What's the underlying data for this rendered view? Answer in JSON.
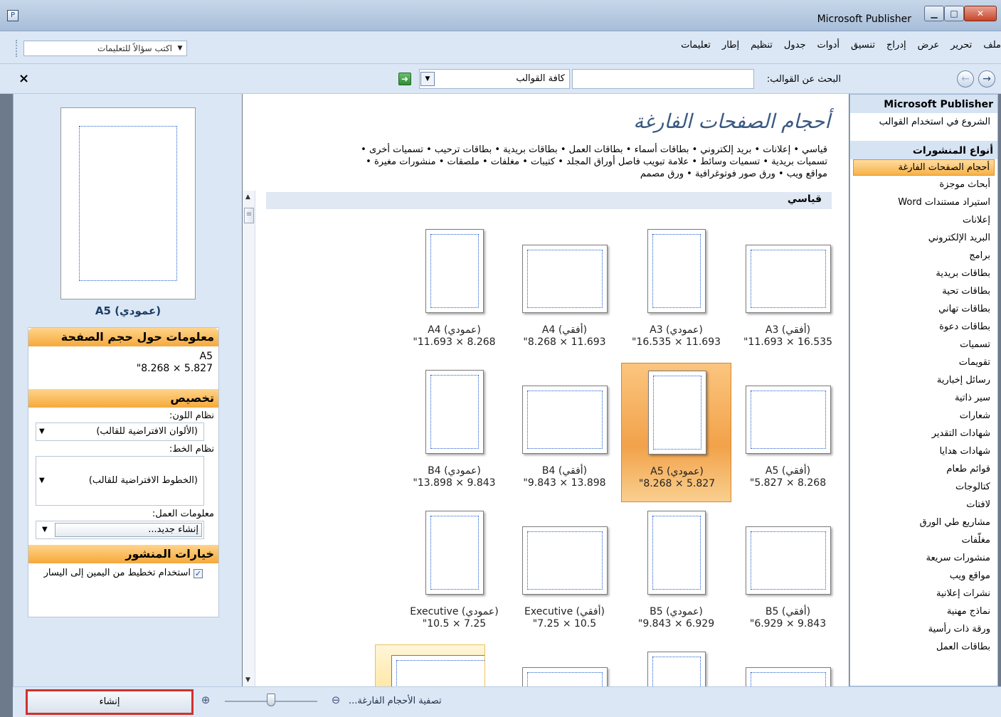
{
  "window": {
    "title": "Microsoft Publisher",
    "min_label": "▁",
    "max_label": "□",
    "close_label": "✕"
  },
  "menu": {
    "items": [
      "ملف",
      "تحرير",
      "عرض",
      "إدراج",
      "تنسيق",
      "أدوات",
      "جدول",
      "تنظيم",
      "إطار",
      "تعليمات"
    ],
    "ask_placeholder": "اكتب سؤالاً للتعليمات"
  },
  "toolbar": {
    "search_label": "البحث عن القوالب:",
    "search_value": "",
    "category_value": "كافة القوالب",
    "close_label": "×"
  },
  "nav": {
    "app_header": "Microsoft Publisher",
    "getting_started": "الشروع في استخدام القوالب",
    "types_header": "أنواع المنشورات",
    "items": [
      "أحجام الصفحات الفارغة",
      "أبحاث موجزة",
      "استيراد مستندات Word",
      "إعلانات",
      "البريد الإلكتروني",
      "برامج",
      "بطاقات بريدية",
      "بطاقات تحية",
      "بطاقات تهاني",
      "بطاقات دعوة",
      "تسميات",
      "تقويمات",
      "رسائل إخبارية",
      "سير ذاتية",
      "شعارات",
      "شهادات التقدير",
      "شهادات هدايا",
      "قوائم طعام",
      "كتالوجات",
      "لافتات",
      "مشاريع طي الورق",
      "مغلّفات",
      "منشورات سريعة",
      "مواقع ويب",
      "نشرات إعلانية",
      "نماذج مهنية",
      "ورقة ذات رأسية",
      "بطاقات العمل"
    ],
    "selected_index": 0
  },
  "content": {
    "title": "أحجام الصفحات الفارغة",
    "categories_line1": "قياسي • إعلانات • بريد إلكتروني • بطاقات أسماء • بطاقات العمل • بطاقات بريدية • بطاقات ترحيب • تسميات أخرى •",
    "categories_line2": "تسميات بريدية • تسميات وسائط • علامة تبويب فاصل أوراق المجلد • كتيبات • مغلفات • ملصقات • منشورات مغيرة •",
    "categories_line3": "مواقع ويب • ورق صور فوتوغرافية • ورق مصمم",
    "section": "قياسي",
    "templates": [
      {
        "name": "A3 (أفقي)",
        "size": "\"11.693 × 16.535"
      },
      {
        "name": "A3 (عمودي)",
        "size": "\"16.535 × 11.693"
      },
      {
        "name": "A4 (أفقي)",
        "size": "\"8.268 × 11.693"
      },
      {
        "name": "A4 (عمودي)",
        "size": "\"11.693 × 8.268"
      },
      {
        "name": "A5 (أفقي)",
        "size": "\"5.827 × 8.268"
      },
      {
        "name": "A5 (عمودي)",
        "size": "\"8.268 × 5.827"
      },
      {
        "name": "B4 (أفقي)",
        "size": "\"9.843 × 13.898"
      },
      {
        "name": "B4 (عمودي)",
        "size": "\"13.898 × 9.843"
      },
      {
        "name": "B5 (أفقي)",
        "size": "\"6.929 × 9.843"
      },
      {
        "name": "B5 (عمودي)",
        "size": "\"9.843 × 6.929"
      },
      {
        "name": "Executive (أفقي)",
        "size": "\"7.25 × 10.5"
      },
      {
        "name": "Executive (عمودي)",
        "size": "\"10.5 × 7.25"
      }
    ],
    "selected_template": "A5 (عمودي)"
  },
  "left": {
    "preview_label": "A5 (عمودي)",
    "info_header": "معلومات حول حجم الصفحة",
    "info_name": "A5",
    "info_size": "\"8.268 × 5.827",
    "customize_header": "تخصيص",
    "color_label": "نظام اللون:",
    "color_value": "(الألوان الافتراضية للقالب)",
    "font_label": "نظام الخط:",
    "font_value": "(الخطوط الافتراضية للقالب)",
    "business_label": "معلومات العمل:",
    "business_value": "إنشاء جديد...",
    "options_header": "خيارات المنشور",
    "rtl_layout": "استخدام تخطيط من اليمين إلى اليسار",
    "rtl_checked": true
  },
  "bottom": {
    "create_label": "إنشاء",
    "filter_label": "تصفية الأحجام الفارغة...",
    "zoom_level": 0.5
  },
  "colors": {
    "chrome": "#dbe7f5",
    "selection": "#f5a93b",
    "accent": "#3a5a82"
  }
}
